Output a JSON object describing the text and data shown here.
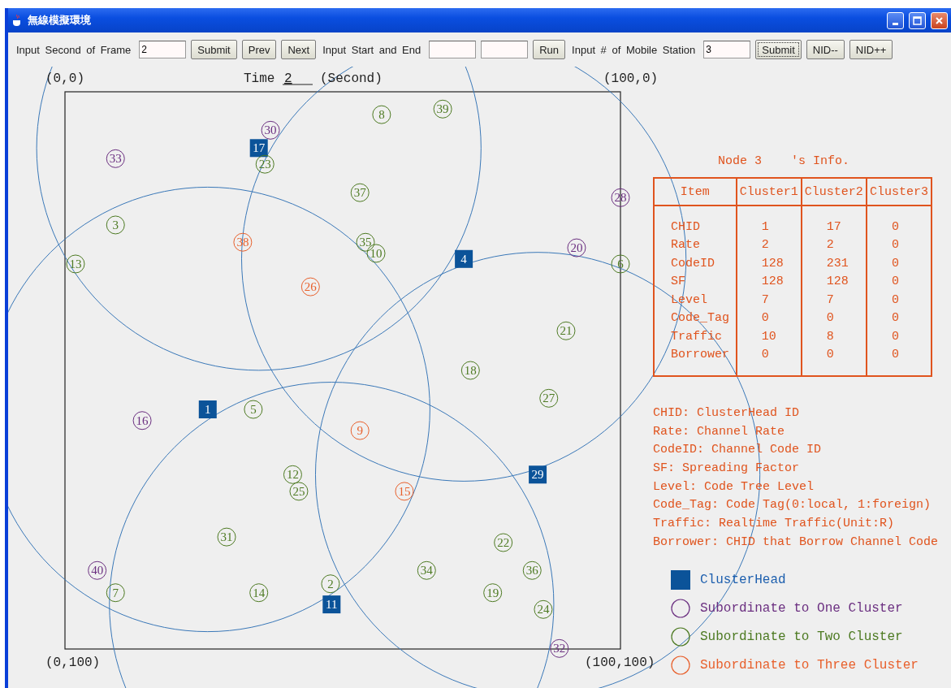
{
  "window": {
    "title": "無線模擬環境"
  },
  "toolbar": [
    {
      "kind": "label",
      "text": "Input Second of Frame"
    },
    {
      "kind": "field",
      "value": "2"
    },
    {
      "kind": "button",
      "label": "Submit",
      "focused": false
    },
    {
      "kind": "button",
      "label": "Prev",
      "focused": false
    },
    {
      "kind": "button",
      "label": "Next",
      "focused": false
    },
    {
      "kind": "label",
      "text": "Input Start and End"
    },
    {
      "kind": "field"
    },
    {
      "kind": "field"
    },
    {
      "kind": "button",
      "label": "Run",
      "focused": false
    },
    {
      "kind": "label",
      "text": "Input # of Mobile Station"
    },
    {
      "kind": "field",
      "value": "3"
    },
    {
      "kind": "button",
      "label": "Submit",
      "focused": true
    },
    {
      "kind": "button",
      "label": "NID--",
      "focused": false
    },
    {
      "kind": "button",
      "label": "NID++",
      "focused": false
    }
  ],
  "plot": {
    "time_label": "Time",
    "time_value": "2",
    "time_unit": "(Second)",
    "corners": [
      "(0,0)",
      "(100,0)",
      "(0,100)",
      "(100,100)"
    ],
    "nodes": [
      {
        "label": "8",
        "kind": "two"
      },
      {
        "label": "39",
        "kind": "two"
      },
      {
        "label": "30",
        "kind": "one"
      },
      {
        "label": "17",
        "kind": "head"
      },
      {
        "label": "33",
        "kind": "one"
      },
      {
        "label": "23",
        "kind": "two"
      },
      {
        "label": "37",
        "kind": "two"
      },
      {
        "label": "28",
        "kind": "one"
      },
      {
        "label": "3",
        "kind": "two"
      },
      {
        "label": "38",
        "kind": "three"
      },
      {
        "label": "35",
        "kind": "two"
      },
      {
        "label": "10",
        "kind": "two"
      },
      {
        "label": "20",
        "kind": "one"
      },
      {
        "label": "13",
        "kind": "two"
      },
      {
        "label": "4",
        "kind": "head"
      },
      {
        "label": "6",
        "kind": "two"
      },
      {
        "label": "26",
        "kind": "three"
      },
      {
        "label": "21",
        "kind": "two"
      },
      {
        "label": "18",
        "kind": "two"
      },
      {
        "label": "27",
        "kind": "two"
      },
      {
        "label": "16",
        "kind": "one"
      },
      {
        "label": "1",
        "kind": "head"
      },
      {
        "label": "5",
        "kind": "two"
      },
      {
        "label": "9",
        "kind": "three"
      },
      {
        "label": "29",
        "kind": "head"
      },
      {
        "label": "12",
        "kind": "two"
      },
      {
        "label": "25",
        "kind": "two"
      },
      {
        "label": "15",
        "kind": "three"
      },
      {
        "label": "31",
        "kind": "two"
      },
      {
        "label": "22",
        "kind": "two"
      },
      {
        "label": "40",
        "kind": "one"
      },
      {
        "label": "34",
        "kind": "two"
      },
      {
        "label": "36",
        "kind": "two"
      },
      {
        "label": "7",
        "kind": "two"
      },
      {
        "label": "14",
        "kind": "two"
      },
      {
        "label": "2",
        "kind": "two"
      },
      {
        "label": "19",
        "kind": "two"
      },
      {
        "label": "11",
        "kind": "head"
      },
      {
        "label": "24",
        "kind": "two"
      },
      {
        "label": "32",
        "kind": "one"
      }
    ]
  },
  "info": {
    "title": "Node 3    's Info.",
    "columns": [
      "Item",
      "Cluster1",
      "Cluster2",
      "Cluster3"
    ],
    "rows": [
      [
        "CHID",
        "1",
        "17",
        "0"
      ],
      [
        "Rate",
        "2",
        "2",
        "0"
      ],
      [
        "CodeID",
        "128",
        "231",
        "0"
      ],
      [
        "SF",
        "128",
        "128",
        "0"
      ],
      [
        "Level",
        "7",
        "7",
        "0"
      ],
      [
        "Code_Tag",
        "0",
        "0",
        "0"
      ],
      [
        "Traffic",
        "10",
        "8",
        "0"
      ],
      [
        "Borrower",
        "0",
        "0",
        "0"
      ]
    ],
    "definitions": [
      "CHID: ClusterHead ID",
      "Rate: Channel Rate",
      "CodeID: Channel Code ID",
      "SF: Spreading Factor",
      "Level: Code Tree Level",
      "Code_Tag: Code Tag(0:local, 1:foreign)",
      "Traffic: Realtime Traffic(Unit:R)",
      "Borrower: CHID that Borrow Channel Code"
    ],
    "legend": [
      {
        "kind": "head",
        "label": "ClusterHead"
      },
      {
        "kind": "one",
        "label": "Subordinate to One Cluster"
      },
      {
        "kind": "two",
        "label": "Subordinate to Two Cluster"
      },
      {
        "kind": "three",
        "label": "Subordinate to Three Cluster"
      }
    ]
  }
}
